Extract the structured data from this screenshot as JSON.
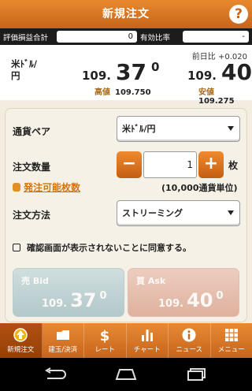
{
  "header": {
    "title": "新規注文",
    "help_icon": "?"
  },
  "summary": {
    "pl_label": "評価損益合計",
    "pl_value": "0",
    "margin_label": "有効比率",
    "margin_value": "-"
  },
  "rates": {
    "pair": "米ﾄﾞﾙ/円",
    "change_label": "前日比",
    "change_value": "+0.020",
    "bid": {
      "p1": "109.",
      "p2": "37",
      "p3": "0",
      "sub_label": "高値",
      "sub_value": "109.750"
    },
    "ask": {
      "p1": "109.",
      "p2": "40",
      "p3": "0",
      "sub_label": "安値",
      "sub_value": "109.275"
    }
  },
  "order": {
    "pair_label": "通貨ペア",
    "pair_value": "米ﾄﾞﾙ/円",
    "qty_label": "注文数量",
    "qty_minus": "−",
    "qty_value": "1",
    "qty_plus": "+",
    "qty_unit": "枚",
    "available_link": "発注可能枚数",
    "unit_note": "(10,000通貨単位)",
    "method_label": "注文方法",
    "method_value": "ストリーミング",
    "confirm_text": "確認画面が表示されないことに同意する。"
  },
  "trade": {
    "bid_label": "売 Bid",
    "bid": {
      "a": "109.",
      "b": "37",
      "c": "0"
    },
    "ask_label": "買 Ask",
    "ask": {
      "a": "109.",
      "b": "40",
      "c": "0"
    }
  },
  "tabs": [
    {
      "label": "新規注文",
      "icon": "up-arrow-circle-icon",
      "active": true
    },
    {
      "label": "建玉/決済",
      "icon": "folder-icon"
    },
    {
      "label": "レート",
      "icon": "dollar-icon"
    },
    {
      "label": "チャート",
      "icon": "bar-chart-icon"
    },
    {
      "label": "ニュース",
      "icon": "info-icon"
    },
    {
      "label": "メニュー",
      "icon": "grid-menu-icon"
    }
  ],
  "colors": {
    "accent": "#d8741c",
    "dark": "#1c1c1c",
    "card": "#f6f1e6"
  }
}
